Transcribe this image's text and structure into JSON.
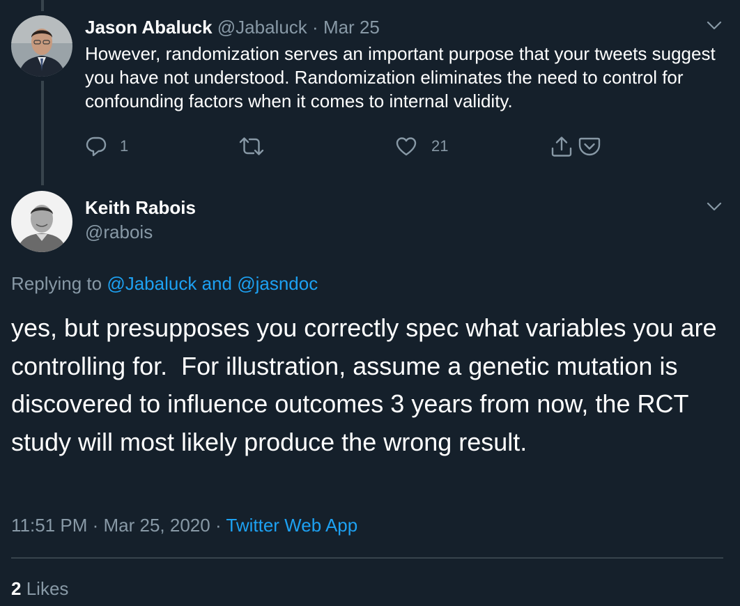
{
  "tweet1": {
    "author_name": "Jason Abaluck",
    "author_handle": "@Jabaluck",
    "separator": "·",
    "date": "Mar 25",
    "text": "However, randomization serves an important purpose that your tweets suggest you have not understood. Randomization eliminates the need to control for confounding factors when it comes to internal validity.",
    "reply_count": "1",
    "like_count": "21",
    "icons": {
      "reply": "reply-icon",
      "retweet": "retweet-icon",
      "like": "heart-icon",
      "share": "share-icon",
      "pocket": "pocket-icon",
      "menu": "chevron-down-icon"
    }
  },
  "tweet2": {
    "author_name": "Keith Rabois",
    "author_handle": "@rabois",
    "replying_prefix": "Replying to",
    "replying_to_1": "@Jabaluck",
    "replying_and": "and",
    "replying_to_2": "@jasndoc",
    "text": "yes, but presupposes you correctly spec what variables you are controlling for.  For illustration, assume a genetic mutation is discovered to influence outcomes 3 years from now, the RCT study will most likely produce the wrong result.",
    "time": "11:51 PM",
    "meta_sep": "·",
    "date": "Mar 25, 2020",
    "meta_sep2": "·",
    "source": "Twitter Web App",
    "likes_count": "2",
    "likes_label": "Likes"
  },
  "colors": {
    "background": "#15202b",
    "text": "#ffffff",
    "muted": "#8899a6",
    "link": "#1da1f2",
    "divider": "#38444d"
  }
}
